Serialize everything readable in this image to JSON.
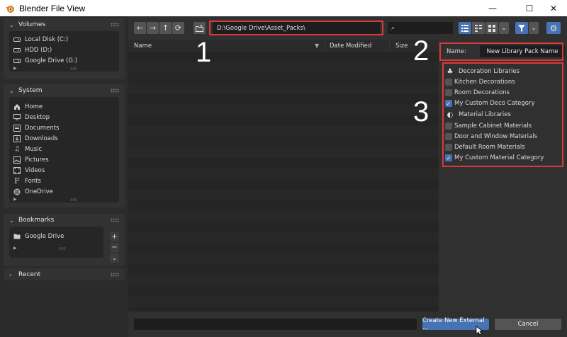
{
  "window": {
    "title": "Blender File View",
    "minimize_glyph": "—",
    "maximize_glyph": "☐",
    "close_glyph": "✕"
  },
  "sidebar": {
    "volumes": {
      "label": "Volumes",
      "items": [
        {
          "label": "Local Disk (C:)",
          "icon": "drive-icon"
        },
        {
          "label": "HDD (D:)",
          "icon": "drive-icon"
        },
        {
          "label": "Google Drive (G:)",
          "icon": "drive-icon"
        }
      ]
    },
    "system": {
      "label": "System",
      "items": [
        {
          "label": "Home",
          "icon": "home-icon"
        },
        {
          "label": "Desktop",
          "icon": "desktop-icon"
        },
        {
          "label": "Documents",
          "icon": "documents-icon"
        },
        {
          "label": "Downloads",
          "icon": "downloads-icon"
        },
        {
          "label": "Music",
          "icon": "music-icon"
        },
        {
          "label": "Pictures",
          "icon": "pictures-icon"
        },
        {
          "label": "Videos",
          "icon": "videos-icon"
        },
        {
          "label": "Fonts",
          "icon": "fonts-icon"
        },
        {
          "label": "OneDrive",
          "icon": "onedrive-icon"
        }
      ]
    },
    "bookmarks": {
      "label": "Bookmarks",
      "items": [
        {
          "label": "Google Drive",
          "icon": "folder-icon"
        }
      ],
      "add_glyph": "+",
      "remove_glyph": "−",
      "menu_glyph": "⌄"
    },
    "recent": {
      "label": "Recent"
    }
  },
  "toolbar": {
    "back_glyph": "←",
    "forward_glyph": "→",
    "parent_glyph": "↑",
    "refresh_glyph": "⟳",
    "path": "D:\\Google Drive\\Asset_Packs\\",
    "search_placeholder": ""
  },
  "columns": {
    "name": "Name",
    "date_modified": "Date Modified",
    "size": "Size"
  },
  "annotations": [
    "1",
    "2",
    "3"
  ],
  "properties": {
    "name_label": "Name:",
    "name_value": "New Library Pack Name",
    "groups": [
      {
        "label": "Decoration Libraries",
        "icon": "decoration-icon",
        "items": [
          {
            "label": "Kitchen Decorations",
            "checked": false
          },
          {
            "label": "Room Decorations",
            "checked": false
          },
          {
            "label": "My Custom Deco Category",
            "checked": true
          }
        ]
      },
      {
        "label": "Material Libraries",
        "icon": "material-icon",
        "items": [
          {
            "label": "Sample Cabinet Materials",
            "checked": false
          },
          {
            "label": "Door and Window Materials",
            "checked": false
          },
          {
            "label": "Default Room Materials",
            "checked": false
          },
          {
            "label": "My Custom Material Category",
            "checked": true
          }
        ]
      }
    ]
  },
  "footer": {
    "create_label": "Create New External ...",
    "cancel_label": "Cancel"
  },
  "colors": {
    "accent": "#4772b3",
    "highlight": "#d9393b"
  }
}
